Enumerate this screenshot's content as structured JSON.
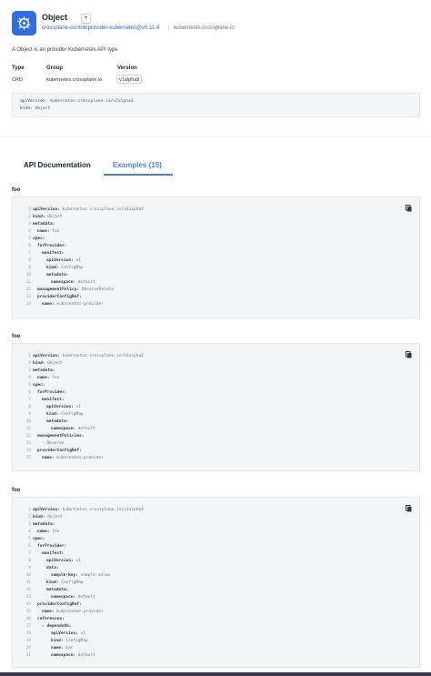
{
  "header": {
    "title": "Object",
    "title_toggle": "▾",
    "provider_link": "crossplane-contrib/provider-kubernetes@v0.11.4",
    "divider": "|",
    "group": "kubernetes.crossplane.io",
    "logo_icon": "kubernetes-helm-icon"
  },
  "description": "A Object is an provider Kubernetes API type",
  "table": {
    "headers": [
      "Type",
      "Group",
      "Version"
    ],
    "type": "CRD",
    "group": "kubernetes.crossplane.io",
    "version": "v1alpha2"
  },
  "summary": {
    "lines": [
      {
        "key": "apiVersion:",
        "value": "kubernetes.crossplane.io/v1alpha2"
      },
      {
        "key": "kind:",
        "value": "Object"
      }
    ]
  },
  "tabs": [
    {
      "label": "API Documentation",
      "active": false
    },
    {
      "label": "Examples (15)",
      "active": true
    }
  ],
  "colors": {
    "accent": "#4d7fd2",
    "logo": "#326ce5",
    "code_bg": "#f4f5f7"
  },
  "examples": [
    {
      "label": "foo",
      "lines": [
        {
          "n": "1",
          "key": "apiVersion:",
          "value": "kubernetes.crossplane.io/v1alpha2",
          "indent": 0
        },
        {
          "n": "2",
          "key": "kind:",
          "value": "Object",
          "indent": 0
        },
        {
          "n": "3",
          "key": "metadata:",
          "value": "",
          "indent": 0
        },
        {
          "n": "4",
          "key": "name:",
          "value": "foo",
          "indent": 1
        },
        {
          "n": "5",
          "key": "spec:",
          "value": "",
          "indent": 0
        },
        {
          "n": "6",
          "key": "forProvider:",
          "value": "",
          "indent": 1
        },
        {
          "n": "7",
          "key": "manifest:",
          "value": "",
          "indent": 2
        },
        {
          "n": "8",
          "key": "apiVersion:",
          "value": "v1",
          "indent": 3
        },
        {
          "n": "9",
          "key": "kind:",
          "value": "ConfigMap",
          "indent": 3
        },
        {
          "n": "10",
          "key": "metadata:",
          "value": "",
          "indent": 3
        },
        {
          "n": "11",
          "key": "namespace:",
          "value": "default",
          "indent": 4
        },
        {
          "n": "12",
          "key": "managementPolicy:",
          "value": "ObserveDelete",
          "indent": 1
        },
        {
          "n": "13",
          "key": "providerConfigRef:",
          "value": "",
          "indent": 1
        },
        {
          "n": "14",
          "key": "name:",
          "value": "kubernetes-provider",
          "indent": 2
        }
      ]
    },
    {
      "label": "foo",
      "lines": [
        {
          "n": "1",
          "key": "apiVersion:",
          "value": "kubernetes.crossplane.io/v1alpha2",
          "indent": 0
        },
        {
          "n": "2",
          "key": "kind:",
          "value": "Object",
          "indent": 0
        },
        {
          "n": "3",
          "key": "metadata:",
          "value": "",
          "indent": 0
        },
        {
          "n": "4",
          "key": "name:",
          "value": "foo",
          "indent": 1
        },
        {
          "n": "5",
          "key": "spec:",
          "value": "",
          "indent": 0
        },
        {
          "n": "6",
          "key": "forProvider:",
          "value": "",
          "indent": 1
        },
        {
          "n": "7",
          "key": "manifest:",
          "value": "",
          "indent": 2
        },
        {
          "n": "8",
          "key": "apiVersion:",
          "value": "v1",
          "indent": 3
        },
        {
          "n": "9",
          "key": "kind:",
          "value": "ConfigMap",
          "indent": 3
        },
        {
          "n": "10",
          "key": "metadata:",
          "value": "",
          "indent": 3
        },
        {
          "n": "11",
          "key": "namespace:",
          "value": "default",
          "indent": 4
        },
        {
          "n": "12",
          "key": "managementPolicies:",
          "value": "",
          "indent": 1
        },
        {
          "n": "13",
          "key": "- Observe",
          "value": "",
          "indent": 2,
          "plain": true
        },
        {
          "n": "14",
          "key": "providerConfigRef:",
          "value": "",
          "indent": 1
        },
        {
          "n": "15",
          "key": "name:",
          "value": "kubernetes-provider",
          "indent": 2
        }
      ]
    },
    {
      "label": "foo",
      "lines": [
        {
          "n": "1",
          "key": "apiVersion:",
          "value": "kubernetes.crossplane.io/v1alpha2",
          "indent": 0
        },
        {
          "n": "2",
          "key": "kind:",
          "value": "Object",
          "indent": 0
        },
        {
          "n": "3",
          "key": "metadata:",
          "value": "",
          "indent": 0
        },
        {
          "n": "4",
          "key": "name:",
          "value": "foo",
          "indent": 1
        },
        {
          "n": "5",
          "key": "spec:",
          "value": "",
          "indent": 0
        },
        {
          "n": "6",
          "key": "forProvider:",
          "value": "",
          "indent": 1
        },
        {
          "n": "7",
          "key": "manifest:",
          "value": "",
          "indent": 2
        },
        {
          "n": "8",
          "key": "apiVersion:",
          "value": "v1",
          "indent": 3
        },
        {
          "n": "9",
          "key": "data:",
          "value": "",
          "indent": 3
        },
        {
          "n": "10",
          "key": "sample-key:",
          "value": "sample-value",
          "indent": 4
        },
        {
          "n": "11",
          "key": "kind:",
          "value": "ConfigMap",
          "indent": 3
        },
        {
          "n": "12",
          "key": "metadata:",
          "value": "",
          "indent": 3
        },
        {
          "n": "13",
          "key": "namespace:",
          "value": "default",
          "indent": 4
        },
        {
          "n": "14",
          "key": "providerConfigRef:",
          "value": "",
          "indent": 1
        },
        {
          "n": "15",
          "key": "name:",
          "value": "kubernetes-provider",
          "indent": 2
        },
        {
          "n": "16",
          "key": "references:",
          "value": "",
          "indent": 1
        },
        {
          "n": "17",
          "key": "- dependsOn:",
          "value": "",
          "indent": 2
        },
        {
          "n": "18",
          "key": "apiVersion:",
          "value": "v1",
          "indent": 4
        },
        {
          "n": "19",
          "key": "kind:",
          "value": "ConfigMap",
          "indent": 4
        },
        {
          "n": "20",
          "key": "name:",
          "value": "bar",
          "indent": 4
        },
        {
          "n": "21",
          "key": "namespace:",
          "value": "default",
          "indent": 4
        }
      ]
    }
  ]
}
